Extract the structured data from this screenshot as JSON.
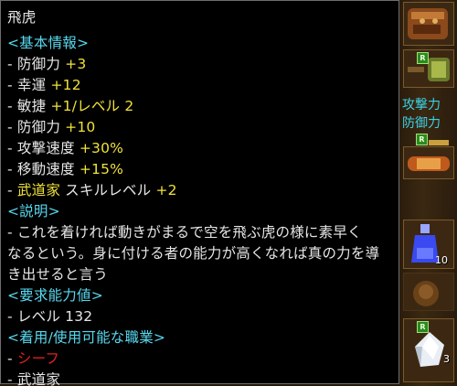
{
  "item": {
    "name": "飛虎"
  },
  "sections": {
    "basic_info": {
      "header": "<基本情報>",
      "stats": [
        {
          "prefix": "- ",
          "label": "防御力 ",
          "value": "+3"
        },
        {
          "prefix": "- ",
          "label": "幸運 ",
          "value": "+12"
        },
        {
          "prefix": "- ",
          "label": "敏捷 ",
          "value": "+1/レベル 2"
        },
        {
          "prefix": "- ",
          "label": "防御力 ",
          "value": "+10"
        },
        {
          "prefix": "- ",
          "label": "攻撃速度 ",
          "value": "+30%"
        },
        {
          "prefix": "- ",
          "label": "移動速度 ",
          "value": "+15%"
        }
      ],
      "skill": {
        "prefix": "- ",
        "class_name": "武道家",
        "label": " スキルレベル ",
        "value": "+2"
      }
    },
    "description": {
      "header": "<説明>",
      "lines": [
        "- これを着ければ動きがまるで空を飛ぶ虎の様に素早く",
        "なるという。身に付ける者の能力が高くなれば真の力を導",
        "き出せると言う"
      ]
    },
    "requirements": {
      "header": "<要求能力値>",
      "lines": [
        "- レベル 132"
      ]
    },
    "jobs": {
      "header": "<着用/使用可能な職業>",
      "items": [
        {
          "prefix": "- ",
          "name": "シーフ",
          "color": "#e0221c"
        },
        {
          "prefix": "- ",
          "name": "武道家",
          "color": "#e6e6e6"
        }
      ]
    }
  },
  "side": {
    "partial_text_1": "攻撃力",
    "partial_text_2": "防御力",
    "slots": [
      {
        "icon": "glove-icon",
        "badge": "",
        "count": ""
      },
      {
        "icon": "bracelet-icon",
        "badge": "R",
        "count": ""
      },
      {
        "icon": "wand-icon",
        "badge": "R",
        "count": ""
      },
      {
        "icon": "scroll-icon",
        "badge": "",
        "count": ""
      },
      {
        "icon": "potion-icon",
        "badge": "",
        "count": "10"
      },
      {
        "icon": "bag-icon",
        "badge": "",
        "count": ""
      },
      {
        "icon": "crystal-icon",
        "badge": "R",
        "count": "3"
      }
    ]
  },
  "colors": {
    "header": "#58d8ee",
    "value": "#efe23a",
    "text": "#e6e6e6",
    "thief": "#e0221c",
    "background": "#000000",
    "border": "#6e6e6e"
  }
}
